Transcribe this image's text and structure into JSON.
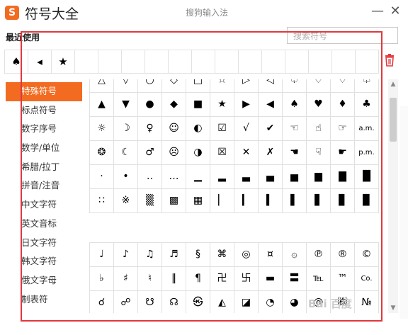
{
  "app": {
    "logo": "S",
    "title": "符号大全",
    "window_title": "搜狗输入法",
    "minimize": "—",
    "close": "✕"
  },
  "recent": {
    "label": "最近使用",
    "symbols": [
      "♠",
      "◂",
      "★",
      "",
      "",
      "",
      "",
      "",
      "",
      "",
      "",
      "",
      "",
      "",
      "",
      ""
    ]
  },
  "search": {
    "placeholder": "搜索符号"
  },
  "sidebar": {
    "items": [
      {
        "label": "特殊符号",
        "active": true
      },
      {
        "label": "标点符号"
      },
      {
        "label": "数字序号"
      },
      {
        "label": "数学/单位"
      },
      {
        "label": "希腊/拉丁"
      },
      {
        "label": "拼音/注音"
      },
      {
        "label": "中文字符"
      },
      {
        "label": "英文音标"
      },
      {
        "label": "日文字符"
      },
      {
        "label": "韩文字符"
      },
      {
        "label": "俄文字母"
      },
      {
        "label": "制表符"
      }
    ]
  },
  "special_grid": [
    [
      "△",
      "▽",
      "○",
      "◇",
      "□",
      "☆",
      "▷",
      "◁",
      "♤",
      "♡",
      "♢",
      "♧"
    ],
    [
      "▲",
      "▼",
      "●",
      "◆",
      "■",
      "★",
      "▶",
      "◀",
      "♠",
      "♥",
      "♦",
      "♣"
    ],
    [
      "☼",
      "☽",
      "♀",
      "☺",
      "◐",
      "☑",
      "√",
      "✔",
      "☜",
      "☝",
      "☞",
      "a.m."
    ],
    [
      "❂",
      "☾",
      "♂",
      "☹",
      "◑",
      "☒",
      "✕",
      "✗",
      "☚",
      "☟",
      "☛",
      "p.m."
    ],
    [
      "·",
      "•",
      "‥",
      "…",
      "▁",
      "▂",
      "▃",
      "▄",
      "▅",
      "▆",
      "▇",
      "█"
    ],
    [
      "∷",
      "※",
      "▒",
      "▩",
      "▦",
      "▏",
      "▎",
      "▍",
      "▌",
      "▋",
      "▊",
      "▉"
    ]
  ],
  "misc_grid": [
    [
      "♩",
      "♪",
      "♫",
      "♬",
      "§",
      "⌘",
      "◎",
      "¤",
      "۞",
      "℗",
      "®",
      "©"
    ],
    [
      "♭",
      "♯",
      "♮",
      "‖",
      "¶",
      "卍",
      "卐",
      "▬",
      "〓",
      "℡",
      "™",
      "Co."
    ],
    [
      "☌",
      "☍",
      "☋",
      "☊",
      "㉿",
      "◭",
      "◪",
      "◔",
      "◕",
      "@",
      "㈱",
      "№"
    ]
  ],
  "watermark": "Bai 百度"
}
